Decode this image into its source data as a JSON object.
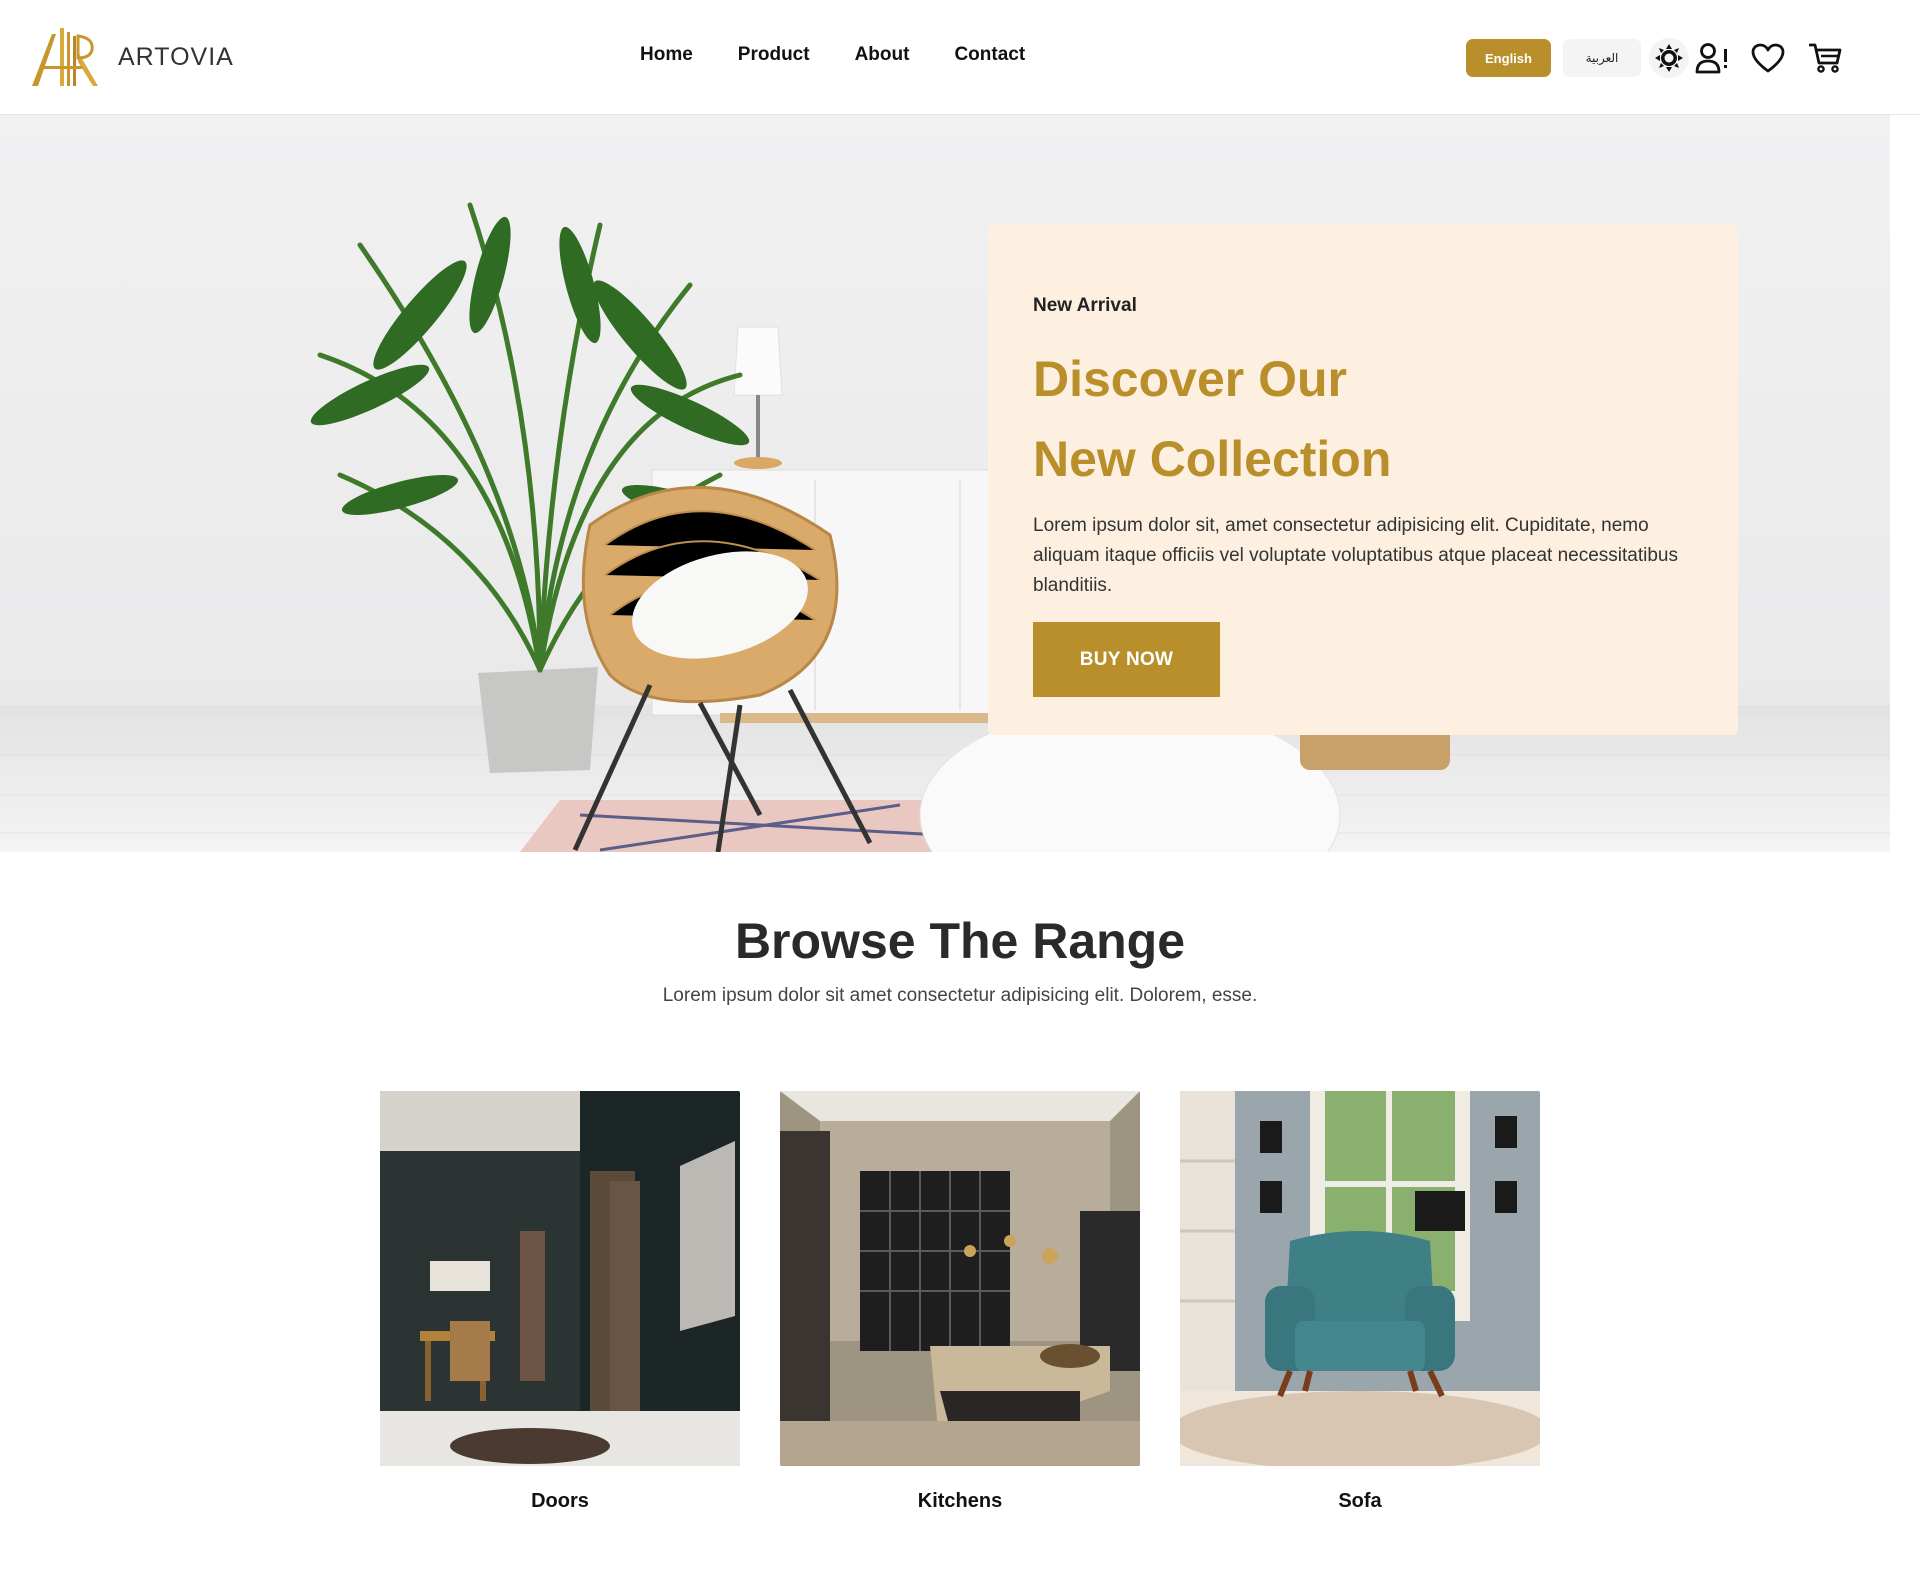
{
  "header": {
    "brand": "ARTOVIA",
    "nav": [
      "Home",
      "Product",
      "About",
      "Contact"
    ],
    "lang_english": "English",
    "lang_arabic": "العربية",
    "icons": [
      "sun-icon",
      "user-alert-icon",
      "heart-icon",
      "cart-icon"
    ],
    "accent_color": "#b98f2c"
  },
  "hero": {
    "kicker": "New Arrival",
    "title_line1": "Discover Our",
    "title_line2": "New Collection",
    "text": "Lorem ipsum dolor sit, amet consectetur adipisicing elit. Cupiditate, nemo aliquam itaque officiis vel voluptate voluptatibus atque placeat necessitatibus blanditiis.",
    "button": "BUY NOW",
    "card_color": "#fdf0e0"
  },
  "browse": {
    "title": "Browse The Range",
    "subtitle": "Lorem ipsum dolor sit amet consectetur adipisicing elit. Dolorem, esse.",
    "items": [
      {
        "label": "Doors"
      },
      {
        "label": "Kitchens"
      },
      {
        "label": "Sofa"
      }
    ]
  }
}
